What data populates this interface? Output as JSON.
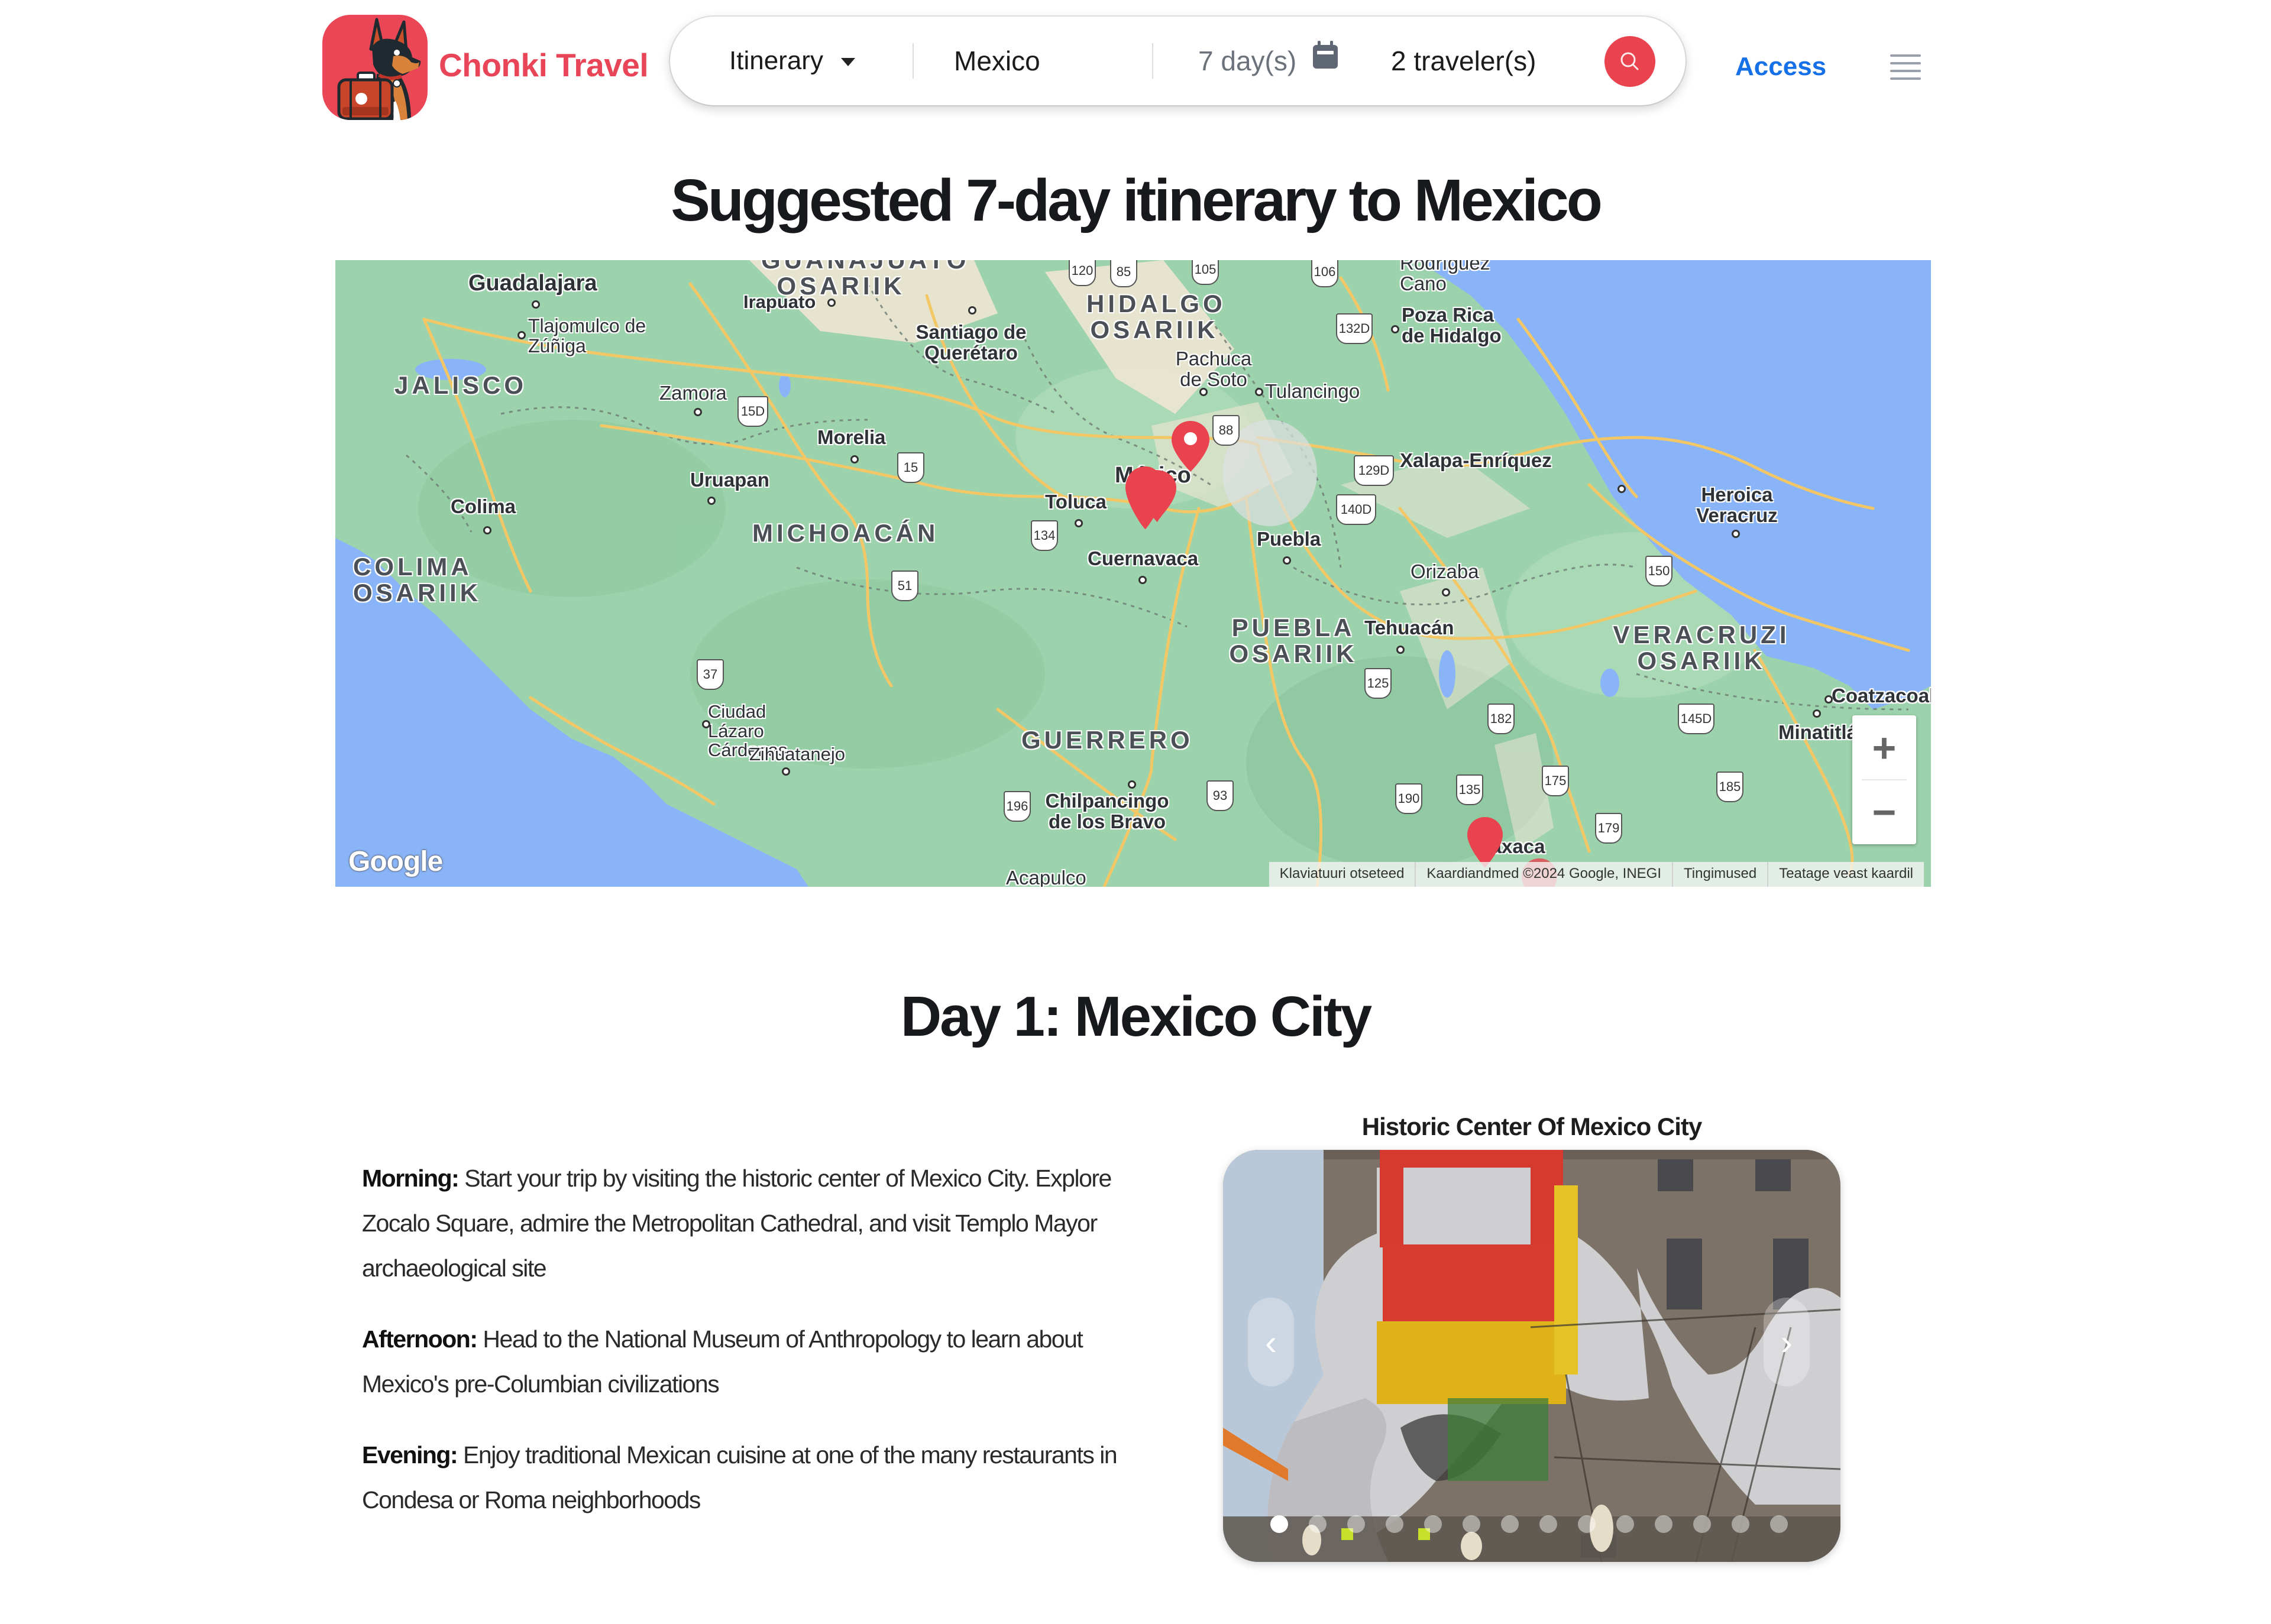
{
  "header": {
    "brand_name": "Chonki Travel",
    "logo_icon": "dog-with-suitcase-logo",
    "search": {
      "type_select": "Itinerary",
      "destination_value": "Mexico",
      "days_value": "7 day(s)",
      "days_icon": "calendar-icon",
      "travelers_value": "2 traveler(s)",
      "search_icon": "search-icon"
    },
    "access_label": "Access",
    "menu_icon": "hamburger-menu-icon"
  },
  "colors": {
    "brand_red": "#e84559",
    "link_blue": "#1670e8",
    "marker_red": "#e9434f",
    "water": "#8ab4f8",
    "land": "#9dd3ac"
  },
  "page_title": "Suggested 7-day itinerary to Mexico",
  "map": {
    "cities": [
      {
        "name": "Guadalajara"
      },
      {
        "name": "Irapuato"
      },
      {
        "name": "Santiago de Querétaro"
      },
      {
        "name": "Tlajomulco de Zúñiga"
      },
      {
        "name": "Zamora"
      },
      {
        "name": "Morelia"
      },
      {
        "name": "Uruapan"
      },
      {
        "name": "Colima"
      },
      {
        "name": "Toluca"
      },
      {
        "name": "Cuernavaca"
      },
      {
        "name": "Pachuca de Soto"
      },
      {
        "name": "Tulancingo"
      },
      {
        "name": "Poza Rica de Hidalgo"
      },
      {
        "name": "Rodríguez Cano"
      },
      {
        "name": "Xalapa-Enríquez"
      },
      {
        "name": "Heroica Veracruz"
      },
      {
        "name": "Puebla"
      },
      {
        "name": "Orizaba"
      },
      {
        "name": "Tehuacán"
      },
      {
        "name": "Ciudad Lázaro Cárdenas"
      },
      {
        "name": "Zihuatanejo"
      },
      {
        "name": "Chilpancingo de los Bravo"
      },
      {
        "name": "Acapulco"
      },
      {
        "name": "Coatzacoalcos"
      },
      {
        "name": "Minatitlán"
      },
      {
        "name": "Oaxaca"
      },
      {
        "name": "México"
      }
    ],
    "states": [
      {
        "name": "JALISCO"
      },
      {
        "name": "MICHOACÁN"
      },
      {
        "name": "COLIMA OSARIIK"
      },
      {
        "name": "GUANAJUATO OSARIIK"
      },
      {
        "name": "HIDALGO OSARIIK"
      },
      {
        "name": "PUEBLA OSARIIK"
      },
      {
        "name": "VERACRUZI OSARIIK"
      },
      {
        "name": "GUERRERO"
      }
    ],
    "highways": [
      "120",
      "85",
      "105",
      "106",
      "132D",
      "15D",
      "15",
      "88",
      "129D",
      "140D",
      "134",
      "51",
      "150",
      "37",
      "125",
      "182",
      "145D",
      "196",
      "93",
      "190",
      "135",
      "175",
      "185",
      "179"
    ],
    "markers": [
      {
        "place": "Mexico City",
        "style": "pin-outline"
      },
      {
        "place": "Mexico City",
        "style": "cluster"
      },
      {
        "place": "Oaxaca",
        "style": "pin"
      },
      {
        "place": "Oaxaca area",
        "style": "pin"
      }
    ],
    "zoom_in_label": "+",
    "zoom_out_label": "−",
    "google_logo": "Google",
    "attribution": [
      "Klaviatuuri otseteed",
      "Kaardiandmed ©2024 Google, INEGI",
      "Tingimused",
      "Teatage veast kaardil"
    ]
  },
  "day": {
    "title": "Day 1: Mexico City",
    "sections": [
      {
        "label": "Morning:",
        "text": "Start your trip by visiting the historic center of Mexico City. Explore Zocalo Square, admire the Metropolitan Cathedral, and visit Templo Mayor archaeological site"
      },
      {
        "label": "Afternoon:",
        "text": "Head to the National Museum of Anthropology to learn about Mexico's pre-Columbian civilizations"
      },
      {
        "label": "Evening:",
        "text": "Enjoy traditional Mexican cuisine at one of the many restaurants in Condesa or Roma neighborhoods"
      }
    ],
    "carousel": {
      "caption": "Historic Center Of Mexico City",
      "prev_label": "‹",
      "next_label": "›",
      "slide_count": 14,
      "active_slide": 1
    }
  }
}
